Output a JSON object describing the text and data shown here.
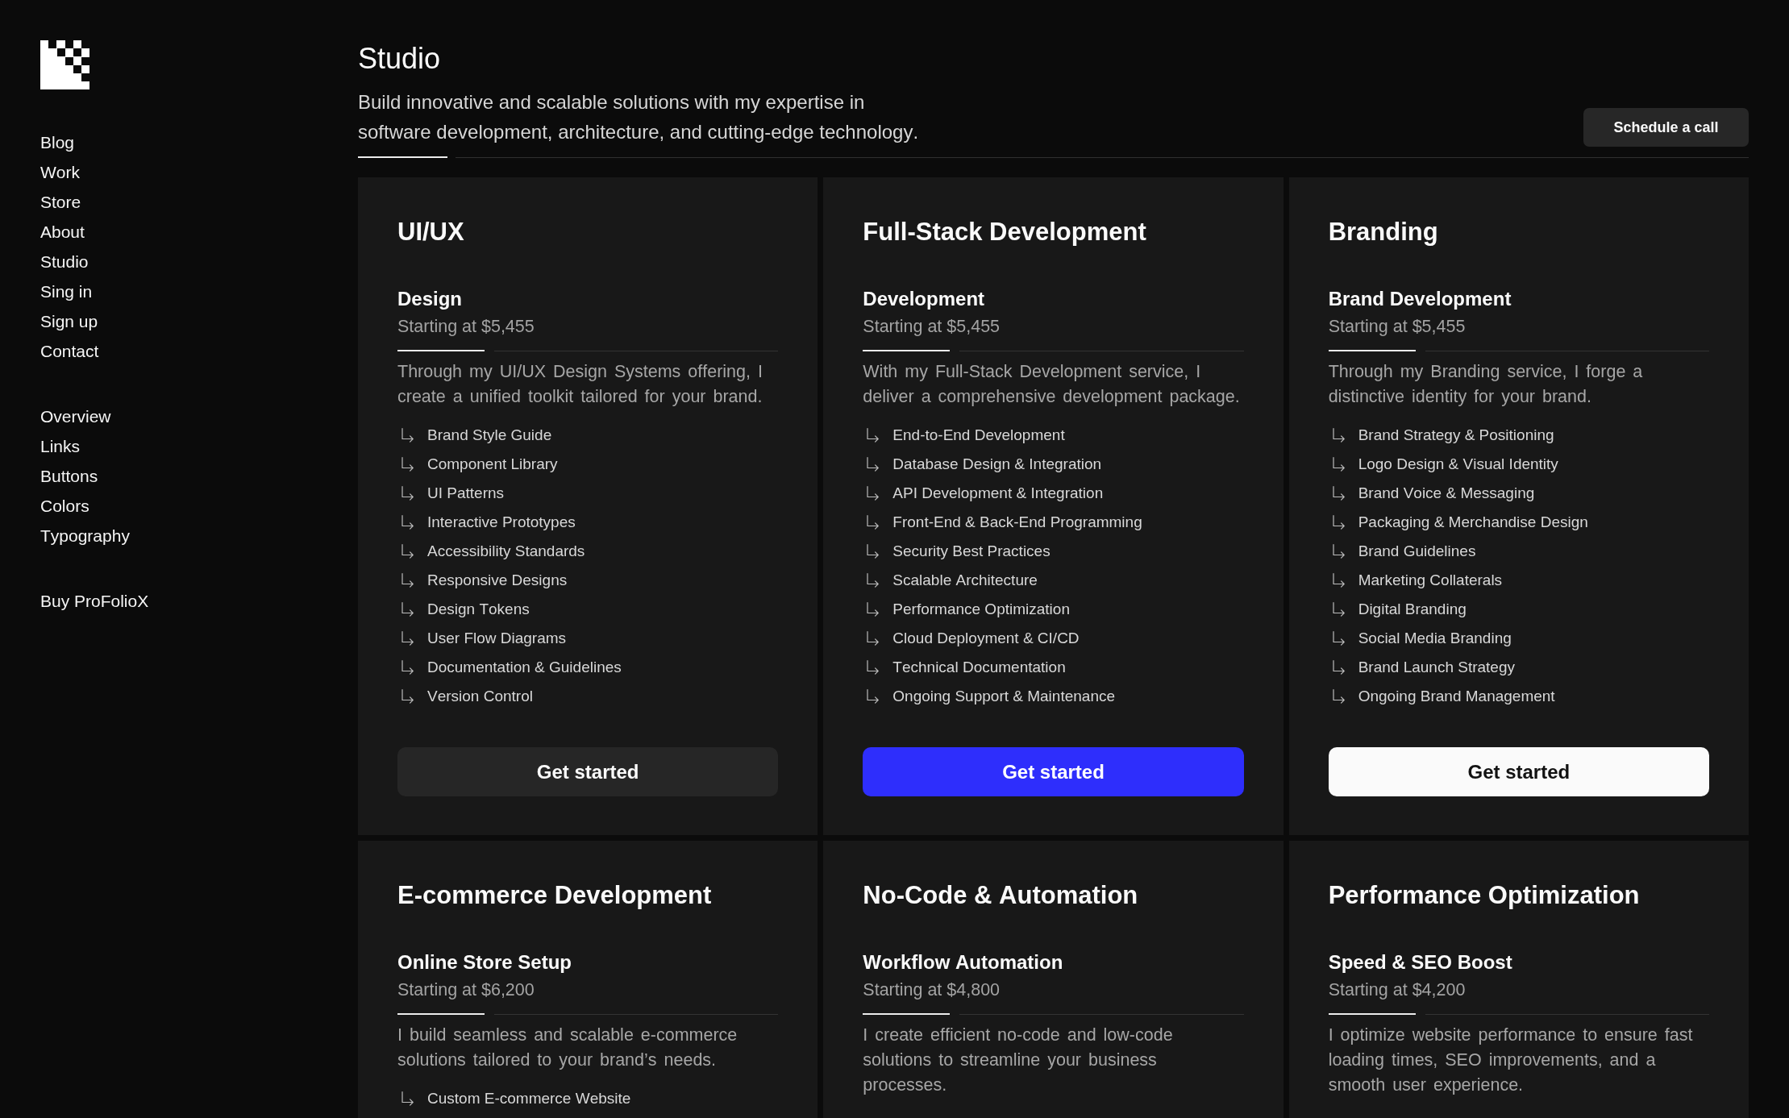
{
  "sidebar": {
    "groups": [
      {
        "links": [
          "Blog",
          "Work",
          "Store",
          "About",
          "Studio",
          "Sing in",
          "Sign up",
          "Contact"
        ]
      },
      {
        "links": [
          "Overview",
          "Links",
          "Buttons",
          "Colors",
          "Typography"
        ]
      },
      {
        "links": [
          "Buy ProFolioX"
        ]
      }
    ]
  },
  "header": {
    "title": "Studio",
    "subtitle": "Build innovative and scalable solutions with my expertise in software development, architecture, and cutting-edge technology.",
    "button": "Schedule a call"
  },
  "services": [
    {
      "title": "UI/UX",
      "package": "Design",
      "price": "Starting at $5,455",
      "description": "Through my UI/UX Design Systems offering, I create a unified toolkit tailored for your brand.",
      "features": [
        "Brand Style Guide",
        "Component Library",
        "UI Patterns",
        "Interactive Prototypes",
        "Accessibility Standards",
        "Responsive Designs",
        "Design Tokens",
        "User Flow Diagrams",
        "Documentation & Guidelines",
        "Version Control"
      ],
      "button": {
        "label": "Get started",
        "kind": "dark"
      }
    },
    {
      "title": "Full-Stack Development",
      "package": "Development",
      "price": "Starting at $5,455",
      "description": "With my Full-Stack Development service, I deliver a comprehensive development package.",
      "features": [
        "End-to-End Development",
        "Database Design & Integration",
        "API Development & Integration",
        "Front-End & Back-End Programming",
        "Security Best Practices",
        "Scalable Architecture",
        "Performance Optimization",
        "Cloud Deployment & CI/CD",
        "Technical Documentation",
        "Ongoing Support & Maintenance"
      ],
      "button": {
        "label": "Get started",
        "kind": "primary"
      }
    },
    {
      "title": "Branding",
      "package": "Brand Development",
      "price": "Starting at $5,455",
      "description": "Through my Branding service, I forge a distinctive identity for your brand.",
      "features": [
        "Brand Strategy & Positioning",
        "Logo Design & Visual Identity",
        "Brand Voice & Messaging",
        "Packaging & Merchandise Design",
        "Brand Guidelines",
        "Marketing Collaterals",
        "Digital Branding",
        "Social Media Branding",
        "Brand Launch Strategy",
        "Ongoing Brand Management"
      ],
      "button": {
        "label": "Get started",
        "kind": "light"
      }
    },
    {
      "title": "E-commerce Development",
      "package": "Online Store Setup",
      "price": "Starting at $6,200",
      "description": "I build seamless and scalable e-commerce solutions tailored to your brand’s needs.",
      "features": [
        "Custom E-commerce Website"
      ]
    },
    {
      "title": "No-Code & Automation",
      "package": "Workflow Automation",
      "price": "Starting at $4,800",
      "description": "I create efficient no-code and low-code solutions to streamline your business processes."
    },
    {
      "title": "Performance Optimization",
      "package": "Speed & SEO Boost",
      "price": "Starting at $4,200",
      "description": "I optimize website performance to ensure fast loading times, SEO improvements, and a smooth user experience."
    }
  ]
}
